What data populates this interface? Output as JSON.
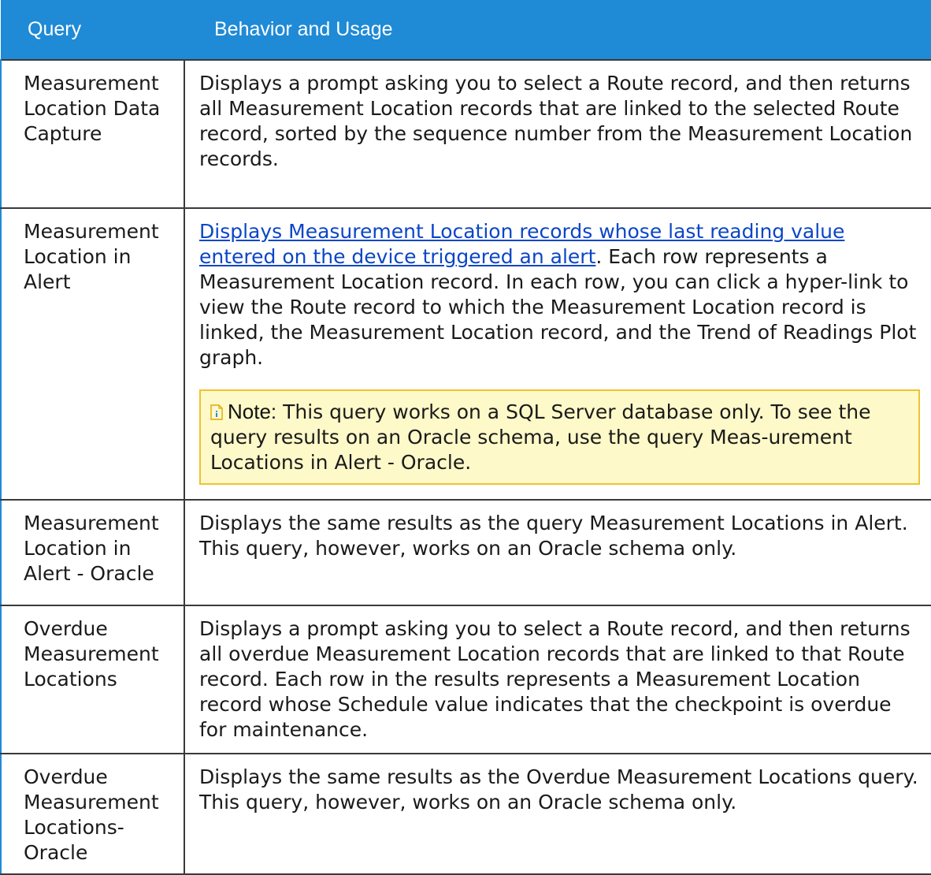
{
  "table": {
    "headers": {
      "query": "Query",
      "behavior": "Behavior and Usage"
    },
    "rows": [
      {
        "query": "Measurement Location Data Capture",
        "behavior": "Displays a prompt asking you to select a Route record, and then returns all Measurement Location records that are linked to the selected Route record, sorted by the sequence number from the Measurement Location records."
      },
      {
        "query": "Measurement Location in Alert",
        "behavior_link": "Displays Measurement Location records whose last reading value entered on the device triggered an alert",
        "behavior": ". Each row represents a Measurement Location record. In each row, you can click a hyper-link to view the Route record to which the Measurement Location record is linked, the Measurement Location record, and the Trend of Readings Plot graph.",
        "note_label": "Note:",
        "note_text": " This query works on a SQL Server database only. To see the query results on an Oracle schema, use the query Meas-urement Locations in Alert - Oracle."
      },
      {
        "query": "Measurement Location in Alert - Oracle",
        "behavior": "Displays the same results as the query Measurement Locations in Alert. This query, however, works on an Oracle schema only."
      },
      {
        "query": "Overdue Measurement Locations",
        "behavior": "Displays a prompt asking you to select a Route record, and then returns all overdue Measurement Location records that are linked to that Route record. Each row in the results represents a Measurement Location record whose Schedule value indicates that the checkpoint is overdue for maintenance."
      },
      {
        "query": "Overdue Measurement Locations-Oracle",
        "behavior": "Displays the same results as the Overdue Measurement Locations query. This query, however, works on an Oracle schema only."
      }
    ]
  },
  "colors": {
    "header_bg": "#1f8ad6",
    "note_bg": "#fdf9c8",
    "note_border": "#f1c232",
    "link": "#0b46c6"
  },
  "icons": {
    "note": "note-icon"
  }
}
